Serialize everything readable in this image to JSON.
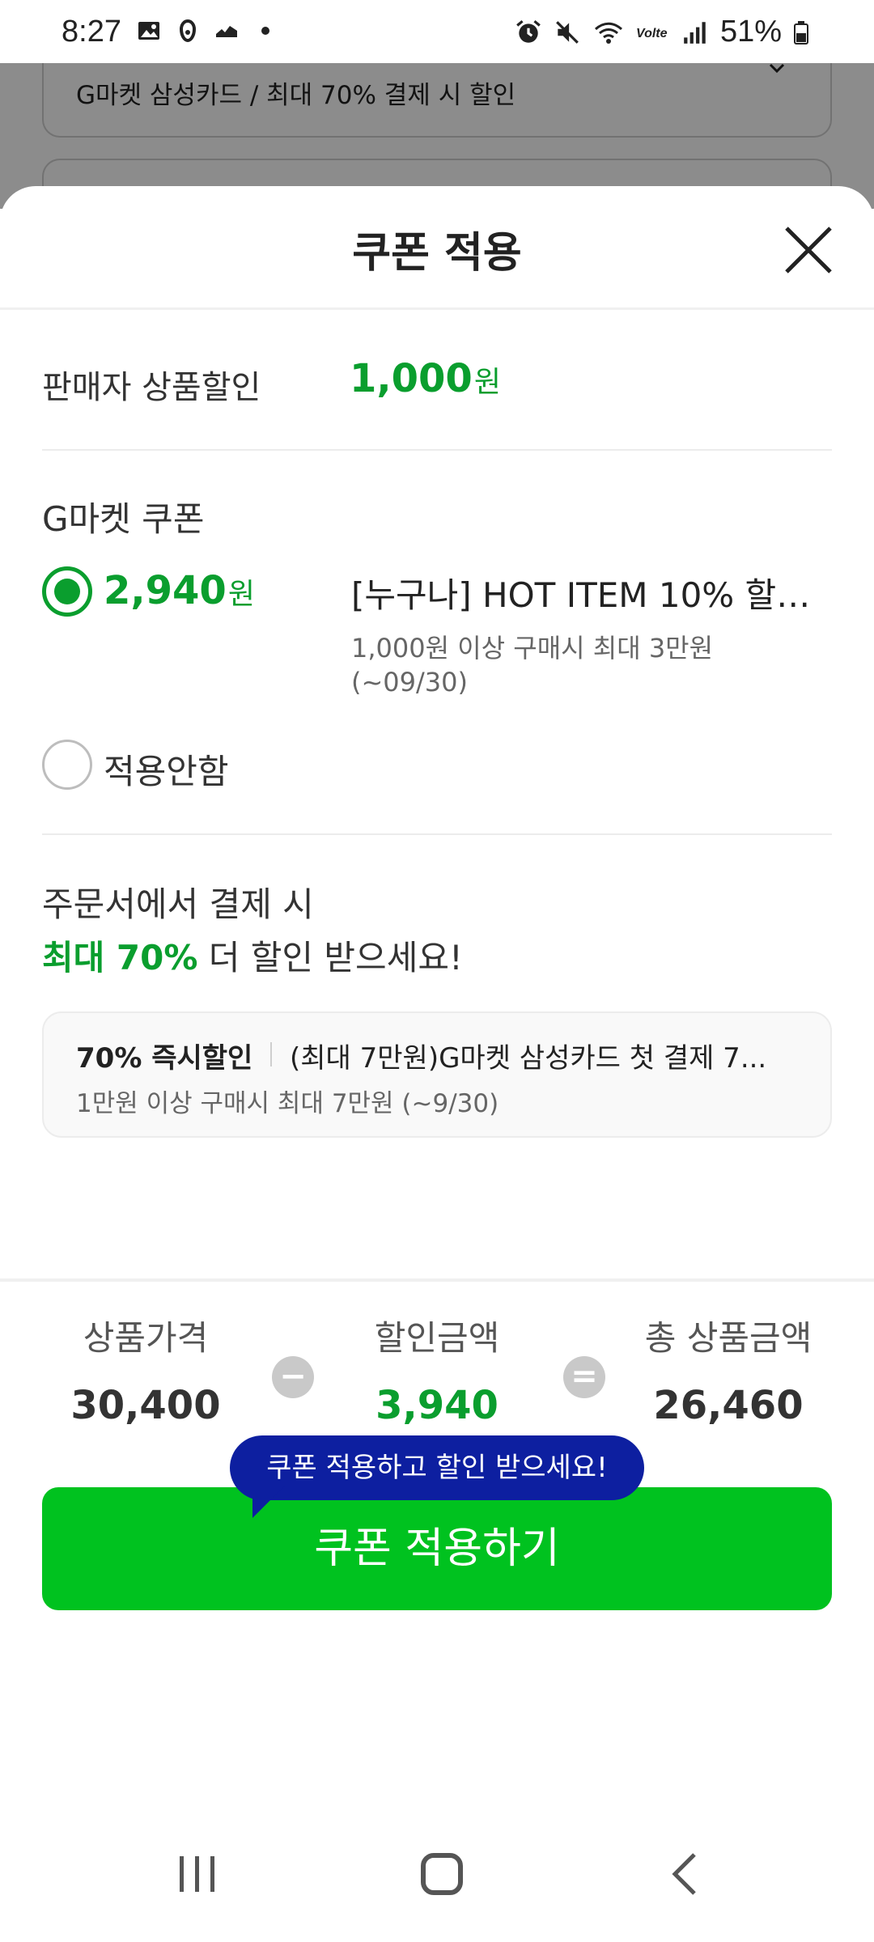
{
  "status_bar": {
    "time": "8:27",
    "battery": "51%",
    "icons": [
      "gallery-icon",
      "notification-icon",
      "app-icon",
      "dot-icon",
      "alarm-icon",
      "mute-icon",
      "wifi-icon",
      "volte-icon",
      "signal-icon",
      "battery-icon"
    ]
  },
  "background": {
    "selected_option": "G마켓 삼성카드 / 최대 70% 결제 시 할인"
  },
  "sheet": {
    "title": "쿠폰 적용",
    "seller_discount": {
      "label": "판매자 상품할인",
      "amount": "1,000",
      "unit": "원"
    },
    "gmarket_coupon": {
      "title": "G마켓 쿠폰",
      "options": [
        {
          "amount": "2,940",
          "unit": "원",
          "name": "[누구나] HOT ITEM 10% 할인...",
          "condition": "1,000원 이상 구매시 최대 3만원",
          "period": "(~09/30)",
          "selected": true
        },
        {
          "label": "적용안함",
          "selected": false
        }
      ]
    },
    "promo": {
      "line1": "주문서에서 결제 시",
      "line2_highlight": "최대 70%",
      "line2_rest": " 더 할인 받으세요!",
      "card": {
        "tag": "70% 즉시할인",
        "title": "(최대 7만원)G마켓 삼성카드 첫 결제 7...",
        "condition": "1만원 이상 구매시 최대 7만원 (~9/30)"
      }
    },
    "summary": {
      "price_label": "상품가격",
      "price_value": "30,400",
      "minus_symbol": "−",
      "discount_label": "할인금액",
      "discount_value": "3,940",
      "equals_symbol": "=",
      "total_label": "총 상품금액",
      "total_value": "26,460"
    },
    "tooltip": "쿠폰 적용하고 할인 받으세요!",
    "apply_button": "쿠폰 적용하기"
  },
  "colors": {
    "accent_green": "#0a9e2e",
    "button_green": "#00c21f",
    "tooltip_blue": "#0d1fa0"
  }
}
